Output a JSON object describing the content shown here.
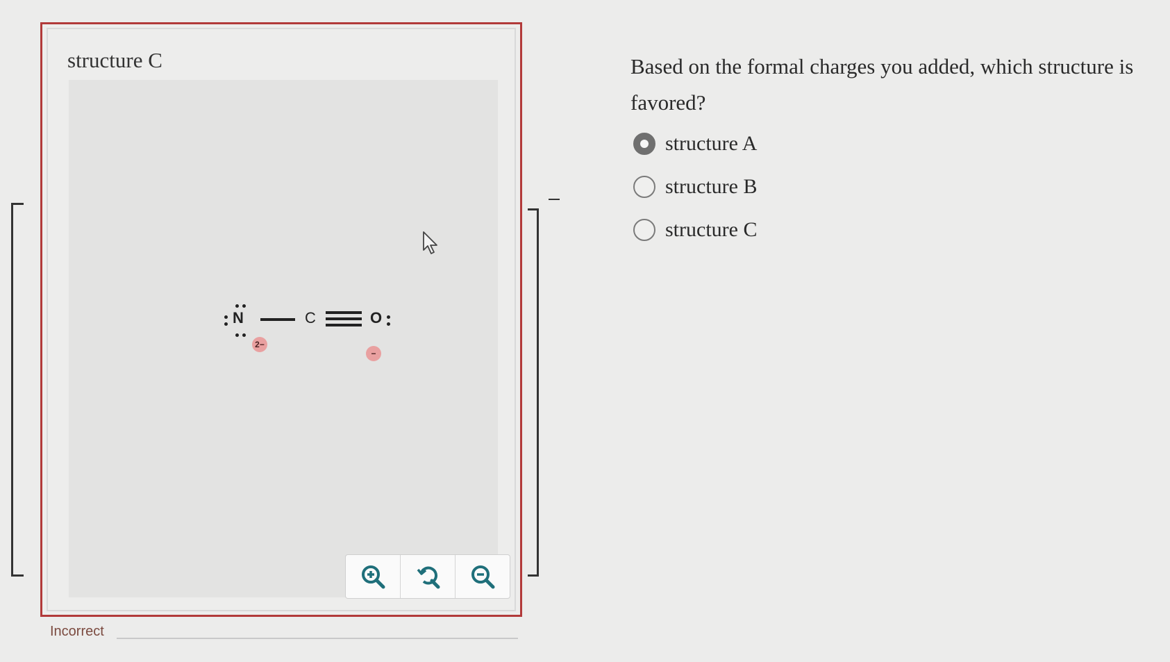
{
  "structure_panel": {
    "title": "structure C",
    "bracket_charge": "−",
    "molecule": {
      "atoms": {
        "n": "N",
        "c": "C",
        "o": "O"
      },
      "formal_charges": {
        "n": "2−",
        "o": "−"
      }
    },
    "toolbar": {
      "zoom_in_icon": "zoom-in-icon",
      "reset_icon": "undo-reset-icon",
      "zoom_out_icon": "zoom-out-icon"
    },
    "feedback_label": "Incorrect"
  },
  "question": {
    "text": "Based on the formal charges you added, which structure is favored?",
    "options": [
      {
        "label": "structure A",
        "selected": true
      },
      {
        "label": "structure B",
        "selected": false
      },
      {
        "label": "structure C",
        "selected": false
      }
    ]
  },
  "colors": {
    "panel_border": "#b23a3a",
    "charge_badge": "#e9a0a0",
    "feedback_text": "#7b4a3f",
    "icon_teal": "#1f6f7a"
  }
}
